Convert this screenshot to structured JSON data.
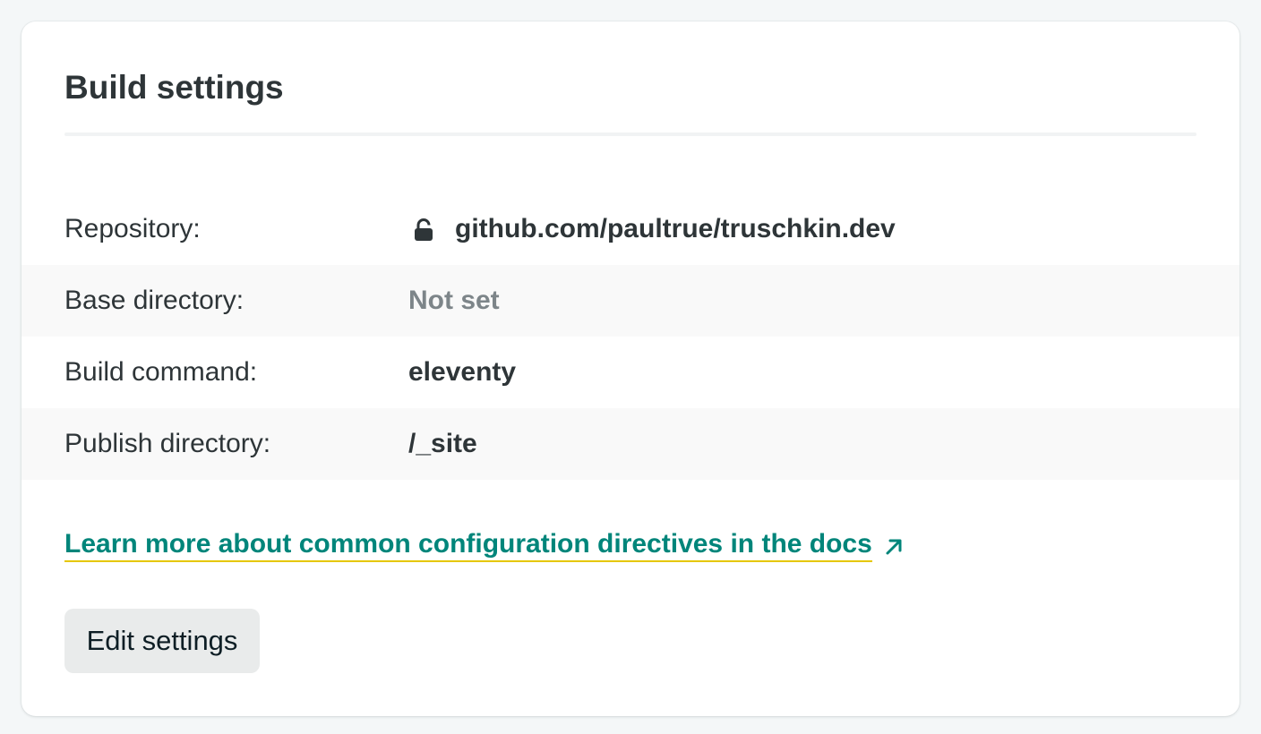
{
  "section": {
    "title": "Build settings"
  },
  "rows": [
    {
      "label": "Repository:",
      "value": "github.com/paultrue/truschkin.dev",
      "icon": "lock-icon"
    },
    {
      "label": "Base directory:",
      "value": "Not set"
    },
    {
      "label": "Build command:",
      "value": "eleventy"
    },
    {
      "label": "Publish directory:",
      "value": "/_site"
    }
  ],
  "docs_link": {
    "label": "Learn more about common configuration directives in the docs",
    "icon": "external-arrow-icon"
  },
  "actions": {
    "edit_label": "Edit settings"
  },
  "colors": {
    "link": "#00857a",
    "link_underline": "#e6c700",
    "muted": "#7d8589",
    "text": "#2e3538",
    "button_bg": "#e9ebeb"
  }
}
